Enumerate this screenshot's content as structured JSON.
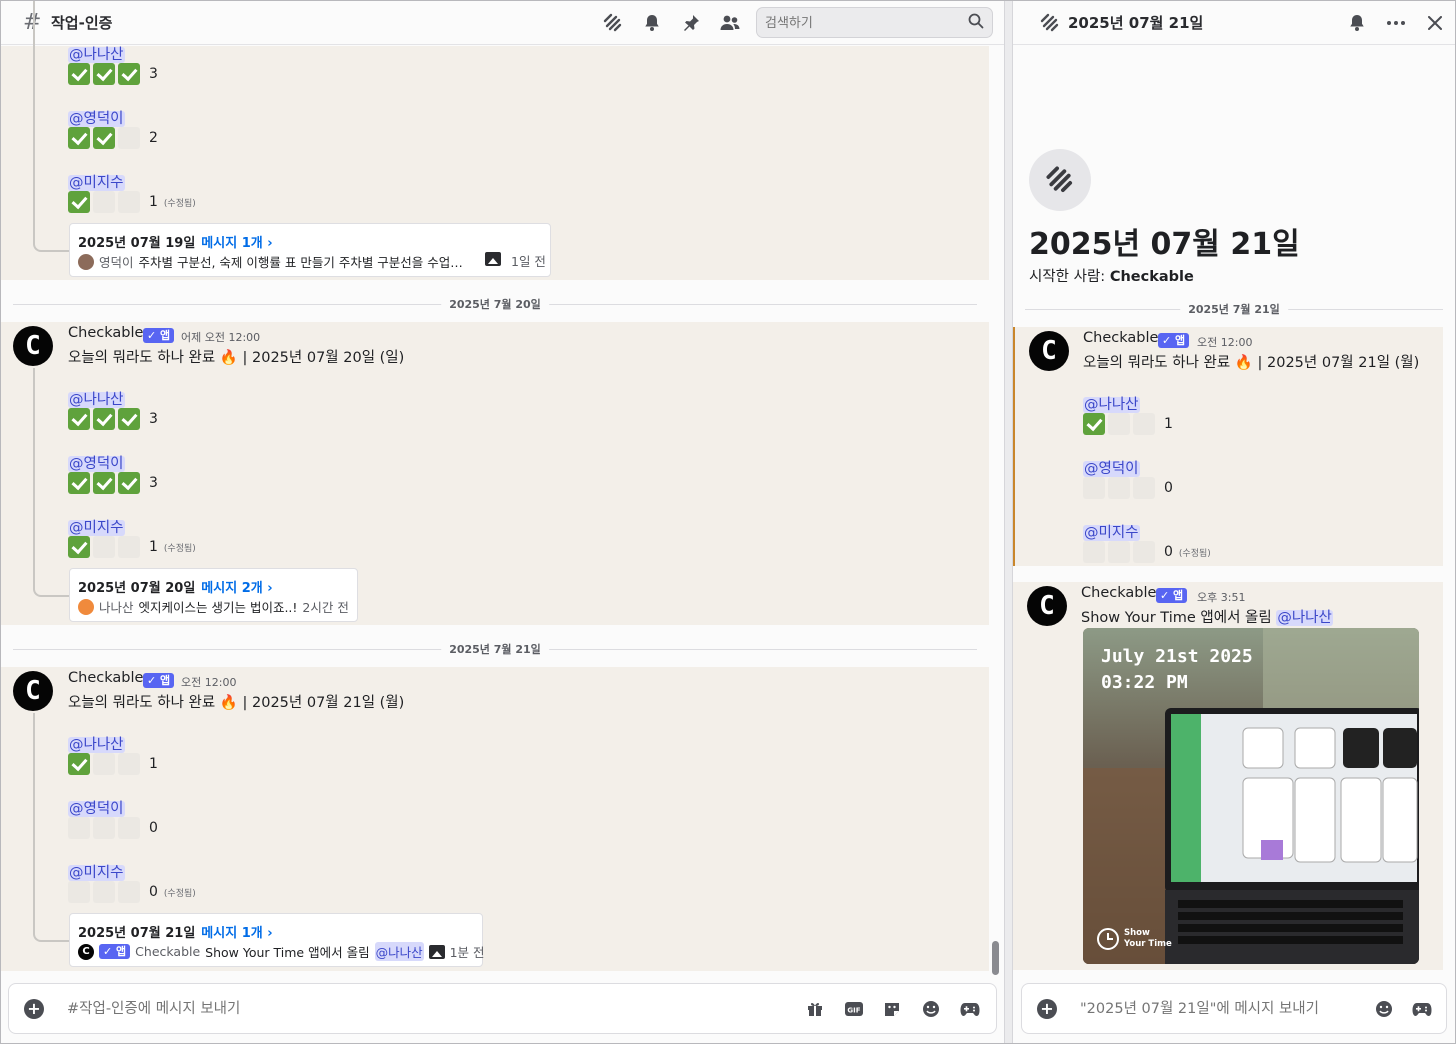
{
  "main": {
    "channel_title": "작업-인증",
    "search": {
      "placeholder": "검색하기"
    },
    "day1": {
      "tail": [
        {
          "mention": "@나나산",
          "checks": [
            1,
            1,
            1
          ],
          "count": "3",
          "edited": ""
        },
        {
          "mention": "@영덕이",
          "checks": [
            1,
            1,
            0
          ],
          "count": "2",
          "edited": ""
        },
        {
          "mention": "@미지수",
          "checks": [
            1,
            0,
            0
          ],
          "count": "1",
          "edited": "(수정됨)"
        }
      ],
      "thread": {
        "title": "2025년 07월 19일",
        "link": "메시지 1개 ›",
        "author": "영덕이",
        "preview": "주차별 구분선, 숙제 이행률 표 만들기 주차별 구분선을 수업으...",
        "time": "1일 전"
      }
    },
    "sep2": "2025년 7월 20일",
    "day2": {
      "author": "Checkable",
      "badge": "✓ 앱",
      "timestamp": "어제 오전 12:00",
      "text": "오늘의 뭐라도 하나 완료 🔥 | 2025년 07월 20일 (일)",
      "rows": [
        {
          "mention": "@나나산",
          "checks": [
            1,
            1,
            1
          ],
          "count": "3",
          "edited": ""
        },
        {
          "mention": "@영덕이",
          "checks": [
            1,
            1,
            1
          ],
          "count": "3",
          "edited": ""
        },
        {
          "mention": "@미지수",
          "checks": [
            1,
            0,
            0
          ],
          "count": "1",
          "edited": "(수정됨)"
        }
      ],
      "thread": {
        "title": "2025년 07월 20일",
        "link": "메시지 2개 ›",
        "author": "나나산",
        "preview": "엣지케이스는 생기는 법이죠..!",
        "time": "2시간 전"
      }
    },
    "sep3": "2025년 7월 21일",
    "day3": {
      "author": "Checkable",
      "badge": "✓ 앱",
      "timestamp": "오전 12:00",
      "text": "오늘의 뭐라도 하나 완료 🔥 | 2025년 07월 21일 (월)",
      "rows": [
        {
          "mention": "@나나산",
          "checks": [
            1,
            0,
            0
          ],
          "count": "1",
          "edited": ""
        },
        {
          "mention": "@영덕이",
          "checks": [
            0,
            0,
            0
          ],
          "count": "0",
          "edited": ""
        },
        {
          "mention": "@미지수",
          "checks": [
            0,
            0,
            0
          ],
          "count": "0",
          "edited": "(수정됨)"
        }
      ],
      "thread": {
        "title": "2025년 07월 21일",
        "link": "메시지 1개 ›",
        "badge": "✓ 앱",
        "author": "Checkable",
        "preview": "Show Your Time 앱에서 올림",
        "mention": "@나나산",
        "time": "1분 전"
      }
    },
    "composer": {
      "placeholder": "#작업-인증에 메시지 보내기"
    }
  },
  "thread_panel": {
    "title": "2025년 07월 21일",
    "big_title": "2025년 07월 21일",
    "starter_prefix": "시작한 사람: ",
    "starter_name": "Checkable",
    "sep": "2025년 7월 21일",
    "msg1": {
      "author": "Checkable",
      "badge": "✓ 앱",
      "timestamp": "오전 12:00",
      "text": "오늘의 뭐라도 하나 완료 🔥 | 2025년 07월 21일 (월)",
      "rows": [
        {
          "mention": "@나나산",
          "checks": [
            1,
            0,
            0
          ],
          "count": "1",
          "edited": ""
        },
        {
          "mention": "@영덕이",
          "checks": [
            0,
            0,
            0
          ],
          "count": "0",
          "edited": ""
        },
        {
          "mention": "@미지수",
          "checks": [
            0,
            0,
            0
          ],
          "count": "0",
          "edited": "(수정됨)"
        }
      ]
    },
    "msg2": {
      "author": "Checkable",
      "badge": "✓ 앱",
      "timestamp": "오후 3:51",
      "text": "Show Your Time 앱에서 올림",
      "mention": "@나나산",
      "photo": {
        "date": "July 21st 2025",
        "time": "03:22 PM",
        "brand_line1": "Show",
        "brand_line2": "Your Time"
      }
    },
    "composer": {
      "placeholder": "\"2025년 07월 21일\"에 메시지 보내기"
    }
  },
  "colors": {
    "accent": "#5865f2",
    "link": "#006ce7",
    "check": "#5fa23c",
    "message_bg": "#f3efe9",
    "mention_bg": "#d7d9fb"
  }
}
